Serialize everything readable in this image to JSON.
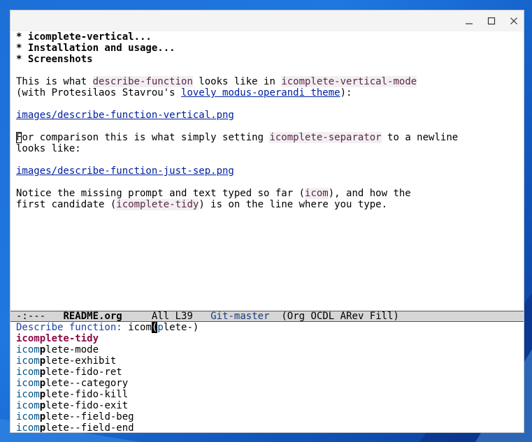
{
  "window": {
    "minimize_glyph": "—",
    "maximize_glyph": "☐",
    "close_glyph": "✕"
  },
  "buffer": {
    "headings": [
      "* icomplete-vertical...",
      "* Installation and usage...",
      "* Screenshots"
    ],
    "para1": {
      "l1_a": "This is what ",
      "l1_code1": "describe-function",
      "l1_b": " looks like in ",
      "l1_code2": "icomplete-vertical-mode",
      "l2_a": "(with Protesilaos Stavrou's ",
      "l2_link": "lovely modus-operandi theme",
      "l2_b": "):"
    },
    "link1": "images/describe-function-vertical.png",
    "para2": {
      "cursor_char": "F",
      "l1_a": "or comparison this is what simply setting ",
      "l1_code": "icomplete-separator",
      "l1_b": " to a newline",
      "l2": "looks like:"
    },
    "link2": "images/describe-function-just-sep.png",
    "para3": {
      "l1_a": "Notice the missing prompt and text typed so far (",
      "l1_code": "icom",
      "l1_b": "), and how the",
      "l2_a": "first candidate (",
      "l2_code": "icomplete-tidy",
      "l2_b": ") is on the line where you type."
    }
  },
  "modeline": {
    "status": "-:---",
    "buffer_name": "README.org",
    "position": "All L39",
    "vc": "Git-master",
    "modes": "(Org OCDL ARev Fill)"
  },
  "minibuffer": {
    "prompt": "Describe function: ",
    "input": "icom",
    "cursor_char": "(",
    "next_char": "p",
    "rest": "lete-)",
    "selected": "icomplete-tidy",
    "candidates": [
      {
        "match": "icom",
        "next": "p",
        "rest": "lete-mode"
      },
      {
        "match": "icom",
        "next": "p",
        "rest": "lete-exhibit"
      },
      {
        "match": "icom",
        "next": "p",
        "rest": "lete-fido-ret"
      },
      {
        "match": "icom",
        "next": "p",
        "rest": "lete--category"
      },
      {
        "match": "icom",
        "next": "p",
        "rest": "lete-fido-kill"
      },
      {
        "match": "icom",
        "next": "p",
        "rest": "lete-fido-exit"
      },
      {
        "match": "icom",
        "next": "p",
        "rest": "lete--field-beg"
      },
      {
        "match": "icom",
        "next": "p",
        "rest": "lete--field-end"
      }
    ]
  }
}
